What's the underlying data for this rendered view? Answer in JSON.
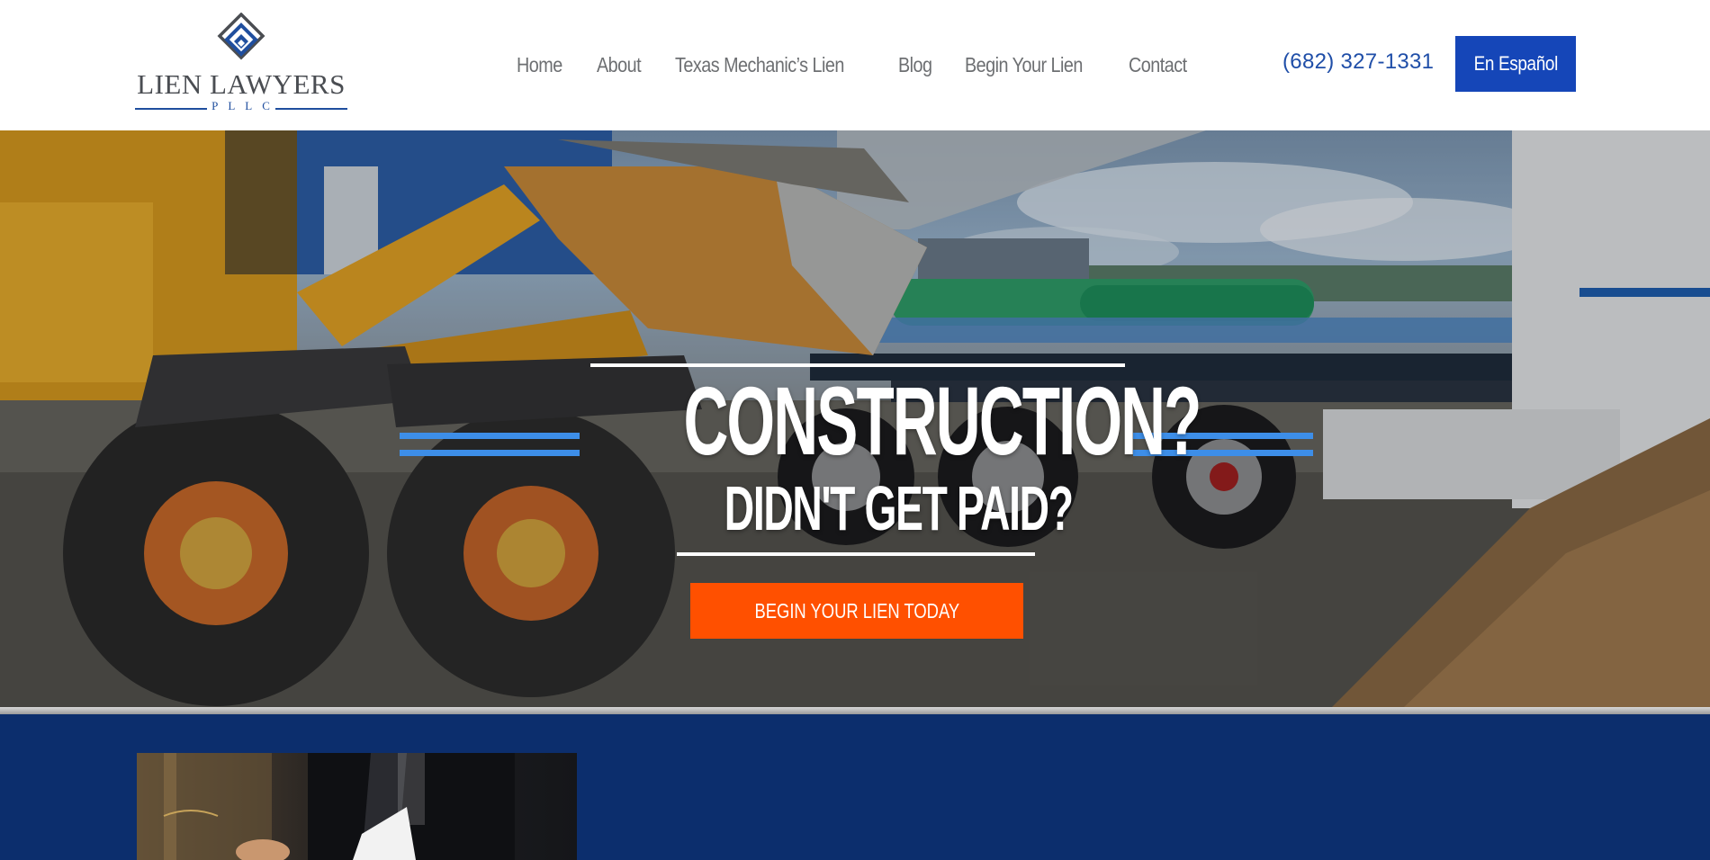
{
  "brand": {
    "name": "LIEN LAWYERS",
    "subtitle": "PLLC",
    "logo_icon": "nested-diamond-icon"
  },
  "nav": {
    "items": [
      {
        "label": "Home"
      },
      {
        "label": "About"
      },
      {
        "label": "Texas Mechanic’s Lien"
      },
      {
        "label": "Blog"
      },
      {
        "label": "Begin Your Lien"
      },
      {
        "label": "Contact"
      }
    ]
  },
  "header": {
    "phone": "(682) 327-1331",
    "language_button": "En Español"
  },
  "hero": {
    "headline": "CONSTRUCTION?",
    "subheadline": "DIDN'T GET PAID?",
    "cta_label": "BEGIN YOUR LIEN TODAY",
    "background_image": "construction-site-photo"
  },
  "colors": {
    "brand_blue": "#1546b8",
    "accent_blue": "#3d8ee8",
    "cta_orange": "#ff5000",
    "navy_section": "#0c2e6d",
    "nav_text": "#6d6f72"
  }
}
